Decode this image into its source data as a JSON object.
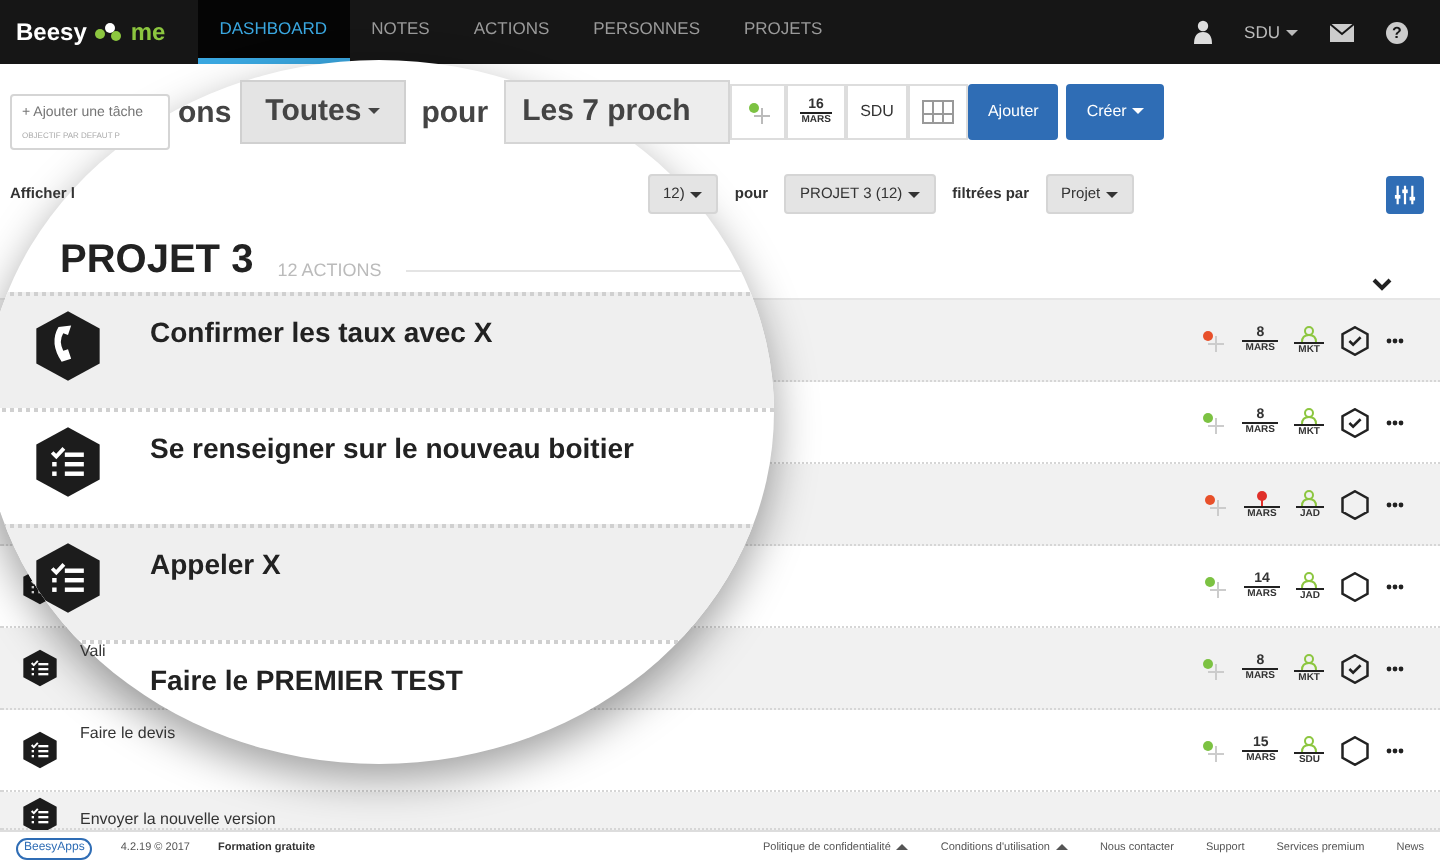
{
  "navbar": {
    "logo_text": "Beesy",
    "logo_suffix": "me",
    "tabs": [
      {
        "label": "DASHBOARD",
        "selected": true
      },
      {
        "label": "NOTES",
        "selected": false
      },
      {
        "label": "ACTIONS",
        "selected": false
      },
      {
        "label": "PERSONNES",
        "selected": false
      },
      {
        "label": "PROJETS",
        "selected": false
      }
    ],
    "user": "SDU",
    "help": "?"
  },
  "toolbar": {
    "task_input": {
      "placeholder": "+ Ajouter une tâche",
      "hint": "OBJECTIF PAR DEFAUT P"
    },
    "fragment": "ons",
    "scope": "Toutes",
    "pour": "pour",
    "period": "Les 7 proch",
    "date": {
      "day": "16",
      "month": "MARS"
    },
    "owner": "SDU",
    "add": "Ajouter",
    "create": "Créer"
  },
  "filter_bar": {
    "label": "Afficher l",
    "count": "12)",
    "pour": "pour",
    "project": "PROJET 3 (12)",
    "filtered_by": "filtrées par",
    "filter": "Projet"
  },
  "lens": {
    "group_title": "PROJET 3",
    "group_count": "12 ACTIONS",
    "rows": [
      {
        "kind": "call",
        "title": "Confirmer les taux avec X"
      },
      {
        "kind": "task",
        "title": "Se renseigner sur le nouveau boitier"
      },
      {
        "kind": "task",
        "title": "Appeler X"
      },
      {
        "title": "Faire le PREMIER TEST"
      }
    ]
  },
  "rows": [
    {
      "color": "#e8502a",
      "overdue": false,
      "day": "8",
      "month": "MARS",
      "owner": "MKT",
      "done": true
    },
    {
      "color": "#7cc242",
      "overdue": false,
      "day": "8",
      "month": "MARS",
      "owner": "MKT",
      "done": true
    },
    {
      "color": "#e8502a",
      "overdue": true,
      "month": "MARS",
      "owner": "JAD",
      "done": false
    },
    {
      "kind": "task",
      "color": "#7cc242",
      "overdue": false,
      "day": "14",
      "month": "MARS",
      "owner": "JAD",
      "done": false
    },
    {
      "kind": "task",
      "title": "Vali",
      "color": "#7cc242",
      "overdue": false,
      "day": "8",
      "month": "MARS",
      "owner": "MKT",
      "done": true
    },
    {
      "kind": "task",
      "title": "Faire le devis",
      "color": "#7cc242",
      "overdue": false,
      "day": "15",
      "month": "MARS",
      "owner": "SDU",
      "done": false
    },
    {
      "kind": "task",
      "title": "Envoyer la nouvelle version"
    }
  ],
  "footer": {
    "logo": "BeesyApps",
    "version": "4.2.19 © 2017",
    "training": "Formation gratuite",
    "links": [
      {
        "label": "Politique de confidentialité",
        "menu": true
      },
      {
        "label": "Conditions d'utilisation",
        "menu": true
      },
      {
        "label": "Nous contacter",
        "menu": false
      },
      {
        "label": "Support",
        "menu": false
      },
      {
        "label": "Services premium",
        "menu": false
      },
      {
        "label": "News",
        "menu": false
      }
    ]
  }
}
